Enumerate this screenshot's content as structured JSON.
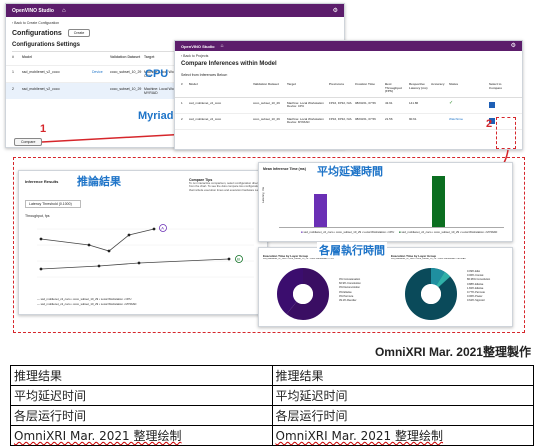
{
  "config_window": {
    "brand": "OpenVINO Studio",
    "back": "Back to Create Configuration",
    "title": "Configurations",
    "create_label": "Create",
    "settings_title": "Configurations Settings",
    "columns": [
      "#",
      "Model",
      "",
      "Validation Dataset",
      "Target"
    ],
    "rows": [
      {
        "num": "1",
        "model": "ssd_mobilenet_v2_coco",
        "link": "Device",
        "dataset": "coco_subset_10_29",
        "target": "Machine: Local Workstation Device: CPU"
      },
      {
        "num": "2",
        "model": "ssd_mobilenet_v2_coco",
        "link": "",
        "dataset": "coco_subset_10_29",
        "target": "Machine: Local Workstation Device: MYRIAD"
      }
    ],
    "compare_label": "Compare",
    "cpu_label": "CPU",
    "myriad_label": "Myriad"
  },
  "compare_window": {
    "back": "Back to Projects",
    "title": "Compare Inferences within Model",
    "subtitle": "Select from Inferences Below:",
    "columns": [
      "#",
      "Model",
      "Validation Dataset",
      "Target",
      "Precisions",
      "Creation Time",
      "Best Throughput (FPS)",
      "Respective Latency (ms)",
      "Accuracy",
      "Status",
      "Select to Compare"
    ],
    "rows": [
      {
        "num": "1",
        "model": "ssd_mobilenet_v2_coco",
        "dataset": "coco_subset_10_29",
        "target": "Machine: Local Workstation Device: CPU",
        "precisions": "FP16, FP32, N/A",
        "created": "08/03/21, 07:56",
        "throughput": "43.91",
        "latency": "141.86",
        "accuracy": "",
        "status": "✓"
      },
      {
        "num": "2",
        "model": "ssd_mobilenet_v2_coco",
        "dataset": "coco_subset_10_29",
        "target": "Machine: Local Workstation Device: MYRIAD",
        "precisions": "FP16, FP32, N/A",
        "created": "08/03/21, 07:56",
        "throughput": "21.56",
        "latency": "90.61",
        "accuracy": "",
        "status": "Watchtime"
      }
    ]
  },
  "callouts": {
    "one": "1",
    "two": "2"
  },
  "inference_panel": {
    "title": "Inference Results",
    "cjk": "推論結果",
    "latency_threshold": "Latency Threshold (0.1000)",
    "y_label": "Throughput, fps",
    "compare_tips_title": "Compare Tips",
    "compare_tips_text": "To run interactive comparison, select configuration directly from the chart. To see the dots compare two configurations that include execution times and execution hardware Layers",
    "legend": [
      {
        "model": "ssd_mobilenet_v2_coco",
        "dataset": "coco_subset_10_29",
        "machine": "Local Workstation",
        "device": "CPU"
      },
      {
        "model": "ssd_mobilenet_v2_coco",
        "dataset": "coco_subset_10_29",
        "machine": "Local Workstation",
        "device": "MYRIAD"
      }
    ],
    "point_a": "A",
    "point_b": "B"
  },
  "latency_panel": {
    "title": "Mean Inference Time (ms)",
    "cjk": "平均延遲時間",
    "y_label": "Latency, ms",
    "legend": [
      {
        "model": "ssd_mobilenet_v2_coco",
        "dataset": "coco_subset_10_29",
        "machine": "Local Workstation",
        "device": "CPU"
      },
      {
        "model": "ssd_mobilenet_v2_coco",
        "dataset": "coco_subset_10_29",
        "machine": "Local Workstation",
        "device": "MYRIAD"
      }
    ],
    "colors": {
      "a": "#6a2fb5",
      "b": "#0b6e20"
    }
  },
  "layer_panel": {
    "cjk": "各層執行時間",
    "left": {
      "title": "Execution Time by Layer Group",
      "subtitle": "ssd_mobilenet_v2_coco  •  coco_subset_10_29  •  Local Workstation  •  CPU",
      "legend": [
        [
          "0%",
          "Concatenation"
        ],
        [
          "60.9%",
          "Convolution"
        ],
        [
          "0%",
          "Deconvolution"
        ],
        [
          "0%",
          "Eltwise"
        ],
        [
          "0%",
          "Permute"
        ],
        [
          "39.1%",
          "Reorder"
        ]
      ]
    },
    "right": {
      "title": "Execution Time by Layer Group",
      "subtitle": "ssd_mobilenet_v2_coco  •  coco_subset_10_29  •  Local Workstation  •  MYRIAD",
      "legend": [
        [
          "0.09%",
          "Eltw"
        ],
        [
          "0.06%",
          "Concat"
        ],
        [
          "86.36%",
          "Convolution"
        ],
        [
          "0.88%",
          "Eltwise"
        ],
        [
          "1.82%",
          "Eltwise"
        ],
        [
          "0.77%",
          "Permute"
        ],
        [
          "0.06%",
          "Power"
        ],
        [
          "0.62%",
          "Sigmoid"
        ]
      ]
    }
  },
  "footer_credit": "OmniXRI Mar. 2021整理製作",
  "table": [
    [
      "推理结果",
      "推理结果"
    ],
    [
      "平均延迟时间",
      "平均延迟时间"
    ],
    [
      "各层运行时间",
      "各层运行时间"
    ],
    [
      "OmniXRI Mar. 2021 整理绘制",
      "OmniXRI Mar. 2021 整理绘制"
    ]
  ]
}
